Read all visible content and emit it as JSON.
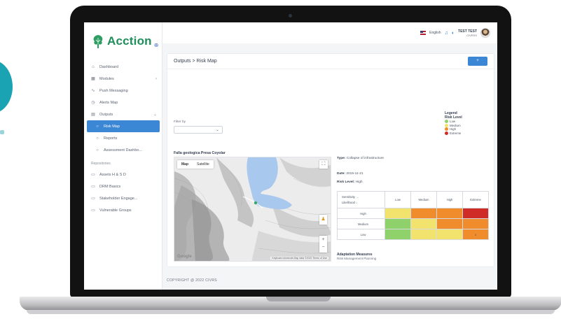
{
  "app": {
    "name": "Acction",
    "badge": "⊕"
  },
  "topbar": {
    "language": "English",
    "user_name": "TEST TEST",
    "user_role": "CIVRSS",
    "icons": [
      "bell-icon",
      "chat-icon"
    ]
  },
  "sidebar": {
    "items": [
      {
        "label": "Dashboard",
        "icon": "home-icon"
      },
      {
        "label": "Modules",
        "icon": "grid-icon",
        "chevron": "›"
      },
      {
        "label": "Push Messaging",
        "icon": "message-icon"
      },
      {
        "label": "Alerts Map",
        "icon": "clock-icon"
      },
      {
        "label": "Outputs",
        "icon": "document-icon",
        "chevron": "⌄"
      }
    ],
    "sub_items": [
      {
        "label": "Risk Map",
        "active": true
      },
      {
        "label": "Reports"
      },
      {
        "label": "Assessment Dashbo..."
      }
    ],
    "section_title": "Repositories",
    "repo_items": [
      {
        "label": "Assets H & S D"
      },
      {
        "label": "DRM Basics"
      },
      {
        "label": "Stakeholder Engage..."
      },
      {
        "label": "Vulnerable Groups"
      }
    ]
  },
  "page": {
    "title": "Outputs > Risk Map",
    "header_button": "+",
    "filter_label": "Filter by",
    "filter_value": ""
  },
  "legend": {
    "title": "Legend",
    "subtitle": "Risk Level",
    "items": [
      {
        "label": "Low",
        "color": "#8fd16a"
      },
      {
        "label": "Medium",
        "color": "#f1e36d"
      },
      {
        "label": "High",
        "color": "#f08c2c"
      },
      {
        "label": "Extreme",
        "color": "#cf2b27"
      }
    ]
  },
  "map": {
    "caption": "Falla geologica Presa Coyolar",
    "tabs": [
      "Map",
      "Satellite"
    ],
    "active_tab": "Map",
    "google_label": "Google",
    "attribution": "Keyboard shortcuts  Map data ©2022  Terms of Use"
  },
  "details": {
    "type_label": "Type:",
    "type_value": "Collapse of infrastructure",
    "date_label": "Date:",
    "date_value": "2015-11-21",
    "risk_label": "Risk Level:",
    "risk_value": "High"
  },
  "matrix": {
    "header_axis_top": "Sensitivity →",
    "header_axis_bottom": "Likelihood ↓",
    "columns": [
      "Low",
      "Medium",
      "High",
      "Extreme"
    ],
    "rows": [
      {
        "label": "High",
        "colors": [
          "#f1e36d",
          "#f08c2c",
          "#f08c2c",
          "#cf2b27"
        ],
        "marks": [
          "",
          "",
          "",
          ""
        ]
      },
      {
        "label": "Medium",
        "colors": [
          "#8fd16a",
          "#f1e36d",
          "#f08c2c",
          "#f08c2c"
        ],
        "marks": [
          "",
          "",
          "",
          ""
        ]
      },
      {
        "label": "Low",
        "colors": [
          "#8fd16a",
          "#f1e36d",
          "#f1e36d",
          "#f08c2c"
        ],
        "marks": [
          "",
          "",
          "",
          "x"
        ]
      }
    ]
  },
  "adaptation": {
    "title": "Adaptation Measures",
    "value": "Risk Management Planning"
  },
  "footer": {
    "copyright": "COPYRIGHT @ 2022 CIVRS"
  }
}
